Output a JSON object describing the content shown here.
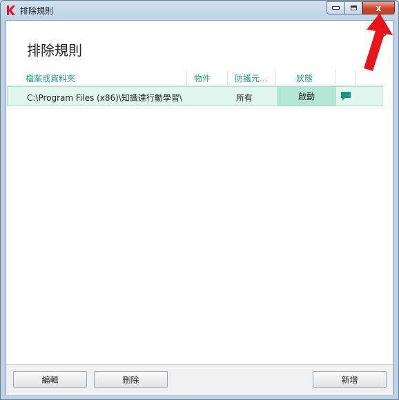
{
  "window": {
    "title": "排除規則",
    "close_label": "x"
  },
  "page": {
    "title": "排除規則"
  },
  "table": {
    "columns": [
      "檔案或資料夾",
      "物件",
      "防護元...",
      "狀態"
    ],
    "rows": [
      {
        "path": "C:\\Program Files (x86)\\知識達行動學習\\",
        "object": "",
        "protection": "所有",
        "status": "啟動"
      }
    ]
  },
  "buttons": {
    "edit": "編輯",
    "delete": "刪除",
    "add": "新增"
  },
  "colors": {
    "accent": "#2a9c84",
    "selected_row": "#e1f6ee",
    "status_cell": "#b4e6d5",
    "annotation_arrow": "#e8141c"
  },
  "icons": {
    "app": "kaspersky-k-icon",
    "help": "help-icon",
    "comment": "comment-icon",
    "annotation": "red-arrow-annotation"
  }
}
